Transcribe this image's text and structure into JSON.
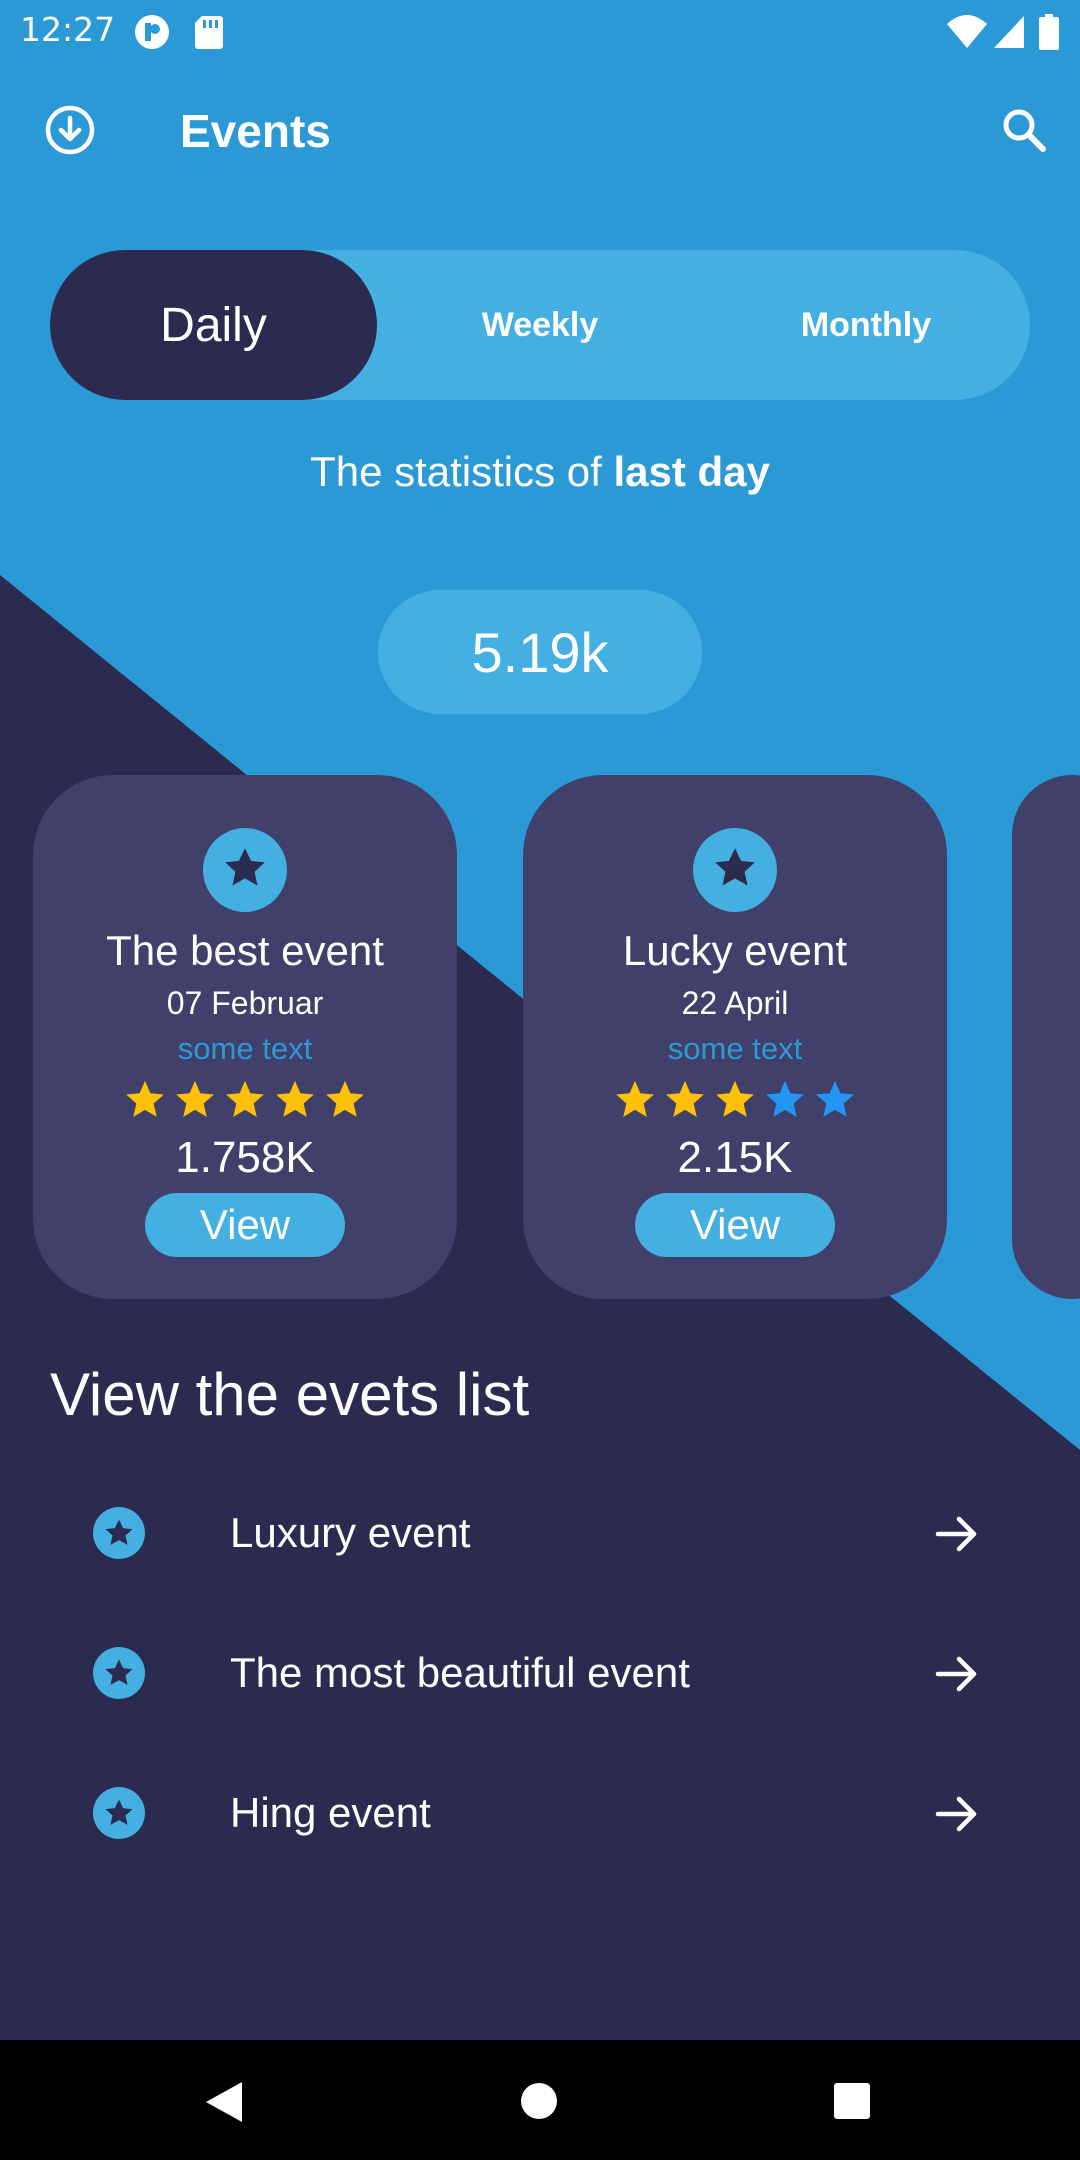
{
  "status_bar": {
    "time": "12:27"
  },
  "app_bar": {
    "title": "Events"
  },
  "period_tabs": {
    "items": [
      "Daily",
      "Weekly",
      "Monthly"
    ],
    "selected": "Daily"
  },
  "stats": {
    "subtitle_prefix": "The statistics of ",
    "subtitle_bold": "last day",
    "total": "5.19k"
  },
  "cards": [
    {
      "name": "The best event",
      "date": "07 Februar",
      "text": "some text",
      "rating": 5,
      "count": "1.758K",
      "button": "View"
    },
    {
      "name": "Lucky event",
      "date": "22 April",
      "text": "some text",
      "rating": 3,
      "count": "2.15K",
      "button": "View"
    }
  ],
  "list": {
    "title": "View the evets list",
    "items": [
      {
        "label": "Luxury event"
      },
      {
        "label": "The most beautiful event"
      },
      {
        "label": "Hing event"
      }
    ]
  },
  "colors": {
    "primary": "#2B99D6",
    "primary_light": "#44AFE1",
    "dark": "#2B2B4F",
    "card": "#40406A",
    "star_filled": "#FFC107",
    "star_empty": "#2196F3"
  },
  "icons": {
    "download": "download-icon",
    "search": "search-icon",
    "star": "star-icon",
    "arrow": "arrow-right-icon",
    "back": "back-icon",
    "home": "home-icon",
    "recents": "recents-icon"
  }
}
